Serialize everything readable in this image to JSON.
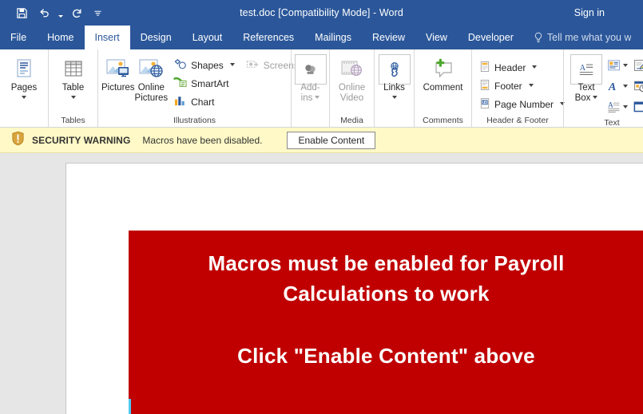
{
  "titlebar": {
    "document_title": "test.doc [Compatibility Mode]  -  Word",
    "signin_label": "Sign in",
    "qat": [
      {
        "name": "save-icon",
        "label": "Save"
      },
      {
        "name": "undo-icon",
        "label": "Undo"
      },
      {
        "name": "redo-icon",
        "label": "Redo"
      },
      {
        "name": "customize-quick-access-toolbar-icon",
        "label": "Customize Quick Access Toolbar"
      }
    ]
  },
  "tabs": [
    {
      "label": "File",
      "active": false
    },
    {
      "label": "Home",
      "active": false
    },
    {
      "label": "Insert",
      "active": true
    },
    {
      "label": "Design",
      "active": false
    },
    {
      "label": "Layout",
      "active": false
    },
    {
      "label": "References",
      "active": false
    },
    {
      "label": "Mailings",
      "active": false
    },
    {
      "label": "Review",
      "active": false
    },
    {
      "label": "View",
      "active": false
    },
    {
      "label": "Developer",
      "active": false
    }
  ],
  "tellme": {
    "placeholder": "Tell me what you w"
  },
  "ribbon": {
    "groups": [
      {
        "label": "",
        "buttons": [
          {
            "label": "Pages",
            "has_dropdown": true
          }
        ]
      },
      {
        "label": "Tables",
        "buttons": [
          {
            "label": "Table",
            "has_dropdown": true
          }
        ]
      },
      {
        "label": "Illustrations",
        "buttons": [
          {
            "label": "Pictures",
            "has_dropdown": false
          },
          {
            "label": "Online\nPictures",
            "line1": "Online",
            "line2": "Pictures",
            "has_dropdown": false
          }
        ],
        "small_buttons": [
          {
            "label": "Shapes",
            "has_dropdown": true,
            "disabled": false
          },
          {
            "label": "SmartArt",
            "has_dropdown": false,
            "disabled": false
          },
          {
            "label": "Chart",
            "has_dropdown": false,
            "disabled": false
          }
        ],
        "extra_small": [
          {
            "label": "Screenshot",
            "has_dropdown": true,
            "disabled": true
          }
        ]
      },
      {
        "label": "",
        "buttons": [
          {
            "line1": "Add-",
            "line2": "ins",
            "has_dropdown": true,
            "disabled": true
          }
        ]
      },
      {
        "label": "Media",
        "buttons": [
          {
            "line1": "Online",
            "line2": "Video",
            "has_dropdown": false,
            "disabled": true
          }
        ]
      },
      {
        "label": "",
        "buttons": [
          {
            "label": "Links",
            "has_dropdown": true
          }
        ]
      },
      {
        "label": "Comments",
        "buttons": [
          {
            "label": "Comment",
            "has_dropdown": false
          }
        ]
      },
      {
        "label": "Header & Footer",
        "small_buttons": [
          {
            "label": "Header",
            "has_dropdown": true
          },
          {
            "label": "Footer",
            "has_dropdown": true
          },
          {
            "label": "Page Number",
            "has_dropdown": true
          }
        ]
      },
      {
        "label": "Text",
        "buttons": [
          {
            "line1": "Text",
            "line2": "Box",
            "has_dropdown": true
          }
        ],
        "icons": [
          {
            "name": "quick-parts-icon",
            "has_dropdown": true
          },
          {
            "name": "signature-line-icon",
            "has_dropdown": true
          },
          {
            "name": "wordart-icon",
            "has_dropdown": true
          },
          {
            "name": "date-and-time-icon",
            "has_dropdown": false
          },
          {
            "name": "drop-cap-icon",
            "has_dropdown": true
          },
          {
            "name": "object-icon",
            "has_dropdown": true
          }
        ]
      }
    ]
  },
  "security_bar": {
    "icon": "shield-warning-icon",
    "title": "SECURITY WARNING",
    "message": "Macros have been disabled.",
    "button_label": "Enable Content",
    "background": "#FEF9C7"
  },
  "document": {
    "banner": {
      "background": "#C00000",
      "line1": "Macros must be enabled for Payroll",
      "line2": "Calculations to work",
      "line3": "Click \"Enable Content\" above"
    }
  },
  "colors": {
    "word_blue": "#2B579A",
    "warning_yellow": "#FEF9C7",
    "banner_red": "#C00000",
    "doc_gray": "#E6E6E6"
  }
}
